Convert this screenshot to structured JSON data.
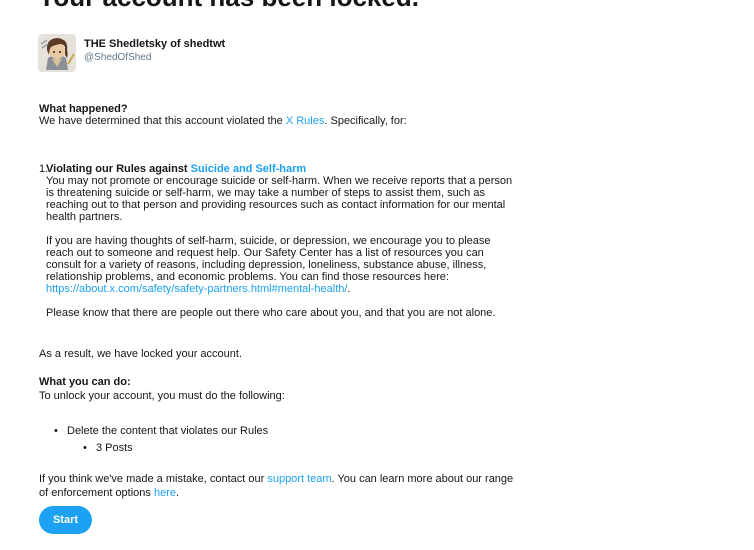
{
  "page": {
    "title": "Your account has been locked."
  },
  "profile": {
    "display_name": "THE Shedletsky of shedtwt",
    "handle": "@ShedOfShed",
    "avatar_icon": "user-avatar-icon"
  },
  "what_happened": {
    "heading": "What happened?",
    "intro_prefix": "We have determined that this account violated the ",
    "intro_link": "X Rules",
    "intro_suffix": ". Specifically, for:"
  },
  "violation": {
    "number": "1.",
    "title_prefix": "Violating our Rules against ",
    "title_link": "Suicide and Self-harm",
    "description": "You may not promote or encourage suicide or self-harm. When we receive reports that a person is threatening suicide or self-harm, we may take a number of steps to assist them, such as reaching out to that person and providing resources such as contact information for our mental health partners.",
    "help_text": "If you are having thoughts of self-harm, suicide, or depression, we encourage you to please reach out to someone and request help. Our Safety Center has a list of resources you can consult for a variety of reasons, including depression, loneliness, substance abuse, illness, relationship problems, and economic problems. You can find those resources here:",
    "help_link": "https://about.x.com/safety/safety-partners.html#mental-health/",
    "help_link_suffix": ".",
    "closing": "Please know that there are people out there who care about you, and that you are not alone."
  },
  "result_text": "As a result, we have locked your account.",
  "what_you_can_do": {
    "heading": "What you can do:",
    "intro": "To unlock your account, you must do the following:",
    "steps": [
      {
        "label": "Delete the content that violates our Rules",
        "sub_items": [
          "3 Posts"
        ]
      }
    ]
  },
  "mistake": {
    "prefix": "If you think we've made a mistake, contact our ",
    "support_link": "support team",
    "middle": ". You can learn more about our range of enforcement options ",
    "here_link": "here",
    "suffix": "."
  },
  "start_button": {
    "label": "Start"
  },
  "colors": {
    "accent": "#1da1f2",
    "text": "#14171a",
    "muted": "#657786"
  }
}
